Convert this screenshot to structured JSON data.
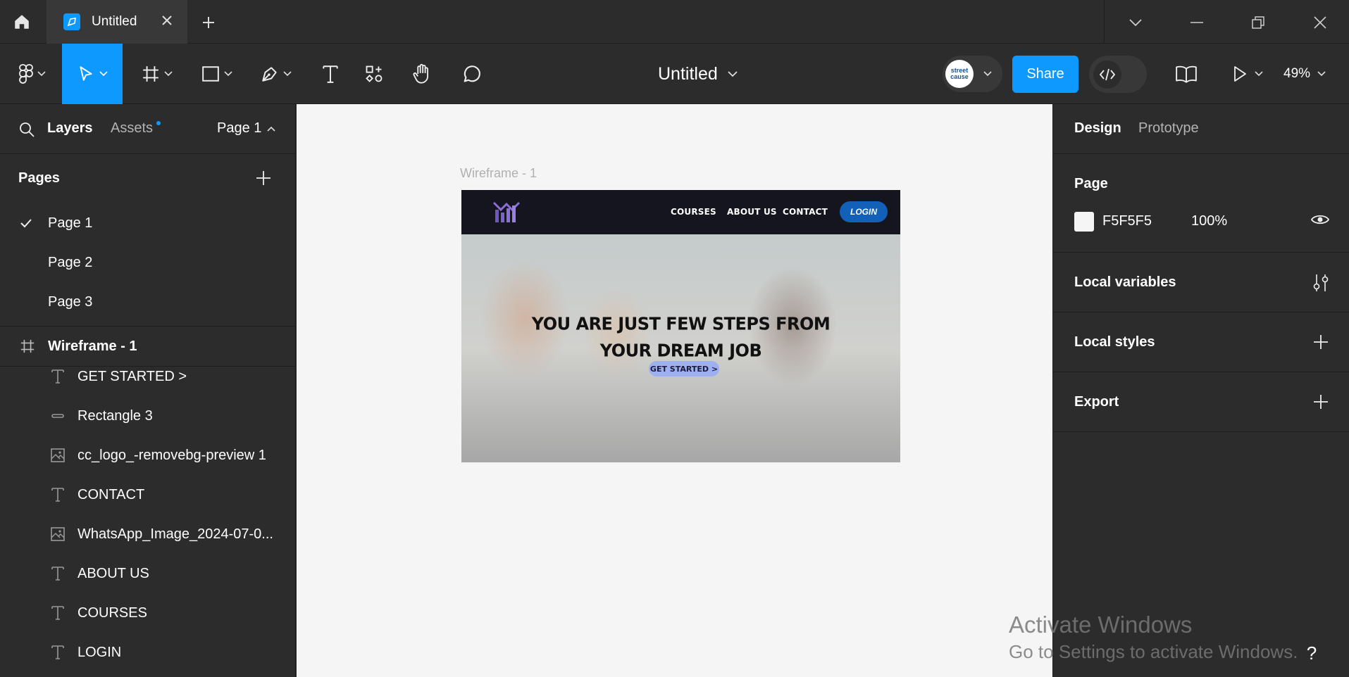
{
  "titlebar": {
    "tab_title": "Untitled"
  },
  "toolbar": {
    "doc_title": "Untitled",
    "share_label": "Share",
    "zoom": "49%",
    "avatar_text": "street cause"
  },
  "left_panel": {
    "layers_tab": "Layers",
    "assets_tab": "Assets",
    "current_page": "Page 1",
    "pages_title": "Pages",
    "pages": [
      {
        "label": "Page 1",
        "selected": true
      },
      {
        "label": "Page 2",
        "selected": false
      },
      {
        "label": "Page 3",
        "selected": false
      }
    ],
    "frame_name": "Wireframe - 1",
    "layers": [
      {
        "label": "GET STARTED >",
        "icon": "text-icon"
      },
      {
        "label": "Rectangle 3",
        "icon": "rectangle-icon"
      },
      {
        "label": "cc_logo_-removebg-preview 1",
        "icon": "image-icon"
      },
      {
        "label": "CONTACT",
        "icon": "text-icon"
      },
      {
        "label": "WhatsApp_Image_2024-07-0...",
        "icon": "image-icon"
      },
      {
        "label": "ABOUT US",
        "icon": "text-icon"
      },
      {
        "label": "COURSES",
        "icon": "text-icon"
      },
      {
        "label": "LOGIN",
        "icon": "text-icon"
      }
    ]
  },
  "canvas": {
    "frame_label": "Wireframe - 1",
    "nav": [
      "COURSES",
      "ABOUT US",
      "CONTACT"
    ],
    "login": "LOGIN",
    "hero_line1": "YOU ARE JUST FEW STEPS FROM",
    "hero_line2": "YOUR DREAM JOB",
    "hero_button": "GET STARTED >"
  },
  "right_panel": {
    "design_tab": "Design",
    "prototype_tab": "Prototype",
    "page_section": "Page",
    "bg_hex": "F5F5F5",
    "bg_opacity": "100%",
    "local_variables": "Local variables",
    "local_styles": "Local styles",
    "export": "Export"
  },
  "watermark": {
    "line1": "Activate Windows",
    "line2": "Go to Settings to activate Windows."
  },
  "help": "?",
  "colors": {
    "accent": "#0d99ff",
    "panel_bg": "#2c2c2c",
    "canvas_bg": "#f5f5f5"
  }
}
